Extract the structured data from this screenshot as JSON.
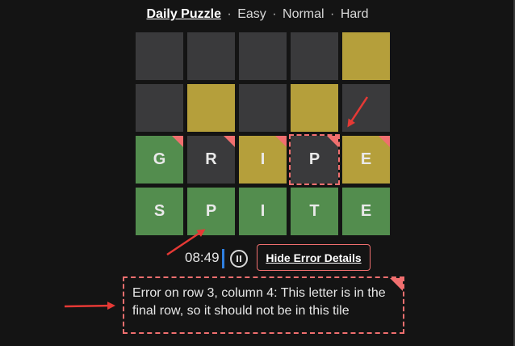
{
  "nav": {
    "daily": "Daily Puzzle",
    "sep": "·",
    "easy": "Easy",
    "normal": "Normal",
    "hard": "Hard"
  },
  "board": {
    "rows": [
      [
        {
          "letter": "",
          "state": "empty"
        },
        {
          "letter": "",
          "state": "empty"
        },
        {
          "letter": "",
          "state": "empty"
        },
        {
          "letter": "",
          "state": "empty"
        },
        {
          "letter": "",
          "state": "yellow"
        }
      ],
      [
        {
          "letter": "",
          "state": "empty"
        },
        {
          "letter": "",
          "state": "yellow"
        },
        {
          "letter": "",
          "state": "empty"
        },
        {
          "letter": "",
          "state": "yellow"
        },
        {
          "letter": "",
          "state": "empty"
        }
      ],
      [
        {
          "letter": "G",
          "state": "green"
        },
        {
          "letter": "R",
          "state": "gray"
        },
        {
          "letter": "I",
          "state": "yellow"
        },
        {
          "letter": "P",
          "state": "gray"
        },
        {
          "letter": "E",
          "state": "yellow"
        }
      ],
      [
        {
          "letter": "S",
          "state": "green"
        },
        {
          "letter": "P",
          "state": "green"
        },
        {
          "letter": "I",
          "state": "green"
        },
        {
          "letter": "T",
          "state": "green"
        },
        {
          "letter": "E",
          "state": "green"
        }
      ]
    ]
  },
  "controls": {
    "timer": "08:49",
    "hide_label": "Hide Error Details"
  },
  "error": {
    "message": "Error on row 3, column 4: This letter is in the final row, so it should not be in this tile"
  },
  "colors": {
    "green": "#538d4e",
    "yellow": "#b59f3b",
    "gray": "#3a3a3c",
    "error": "#f06f6f",
    "background": "#141414"
  },
  "icons": {
    "pause": "pause-icon"
  }
}
